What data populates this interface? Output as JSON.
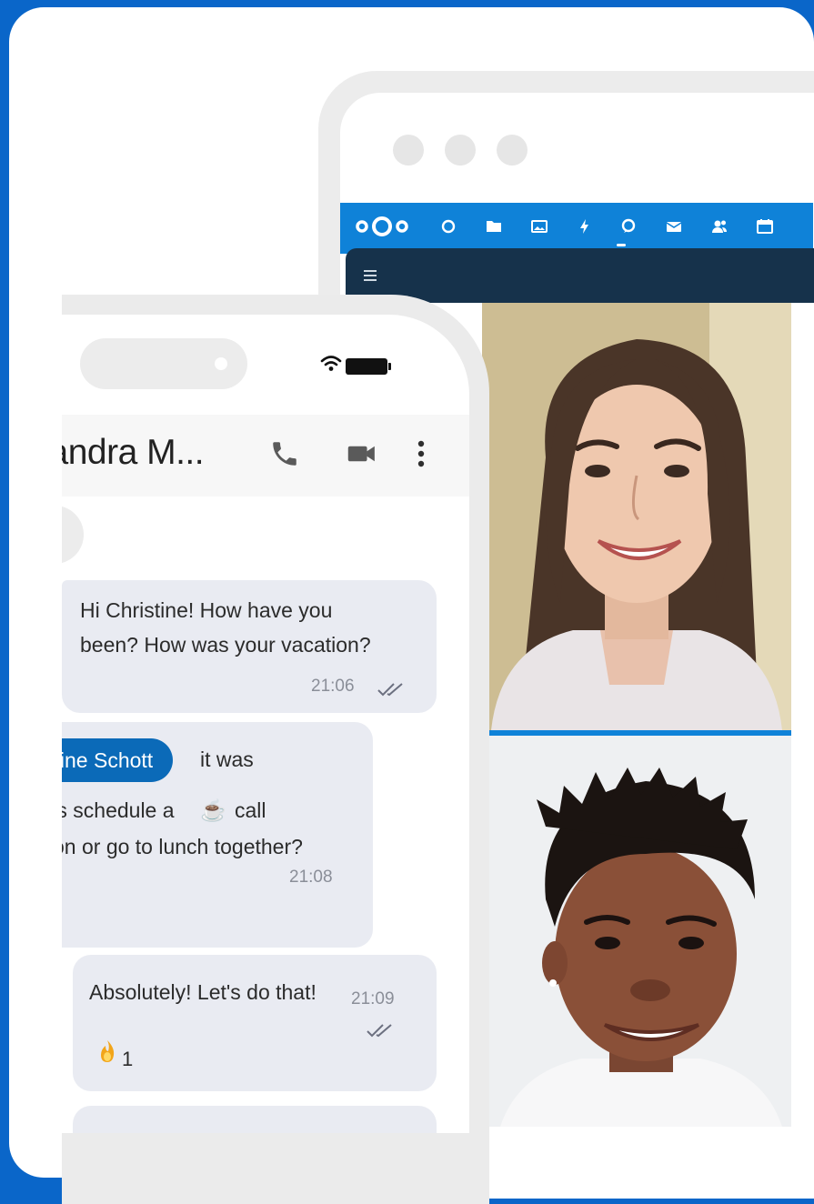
{
  "browser": {
    "app_bar": {
      "icons": [
        "nextcloud-logo",
        "dashboard-icon",
        "files-icon",
        "photos-icon",
        "activity-icon",
        "talk-icon",
        "mail-icon",
        "contacts-icon",
        "calendar-icon"
      ],
      "active_icon": "talk-icon"
    },
    "participants": [
      "participant-video-1",
      "participant-video-2"
    ]
  },
  "phone": {
    "contact_name": "Sandra M...",
    "messages": [
      {
        "line1": "Hi Christine! How have you",
        "line2": "been? How was your vacation?",
        "time": "21:06"
      },
      {
        "mention": "stine Schott",
        "line1_rest": "it was",
        "line2": "'s schedule a",
        "line2_rest": "call",
        "line3": "on or go to lunch together?",
        "time": "21:08"
      },
      {
        "line1": "Absolutely! Let's do that!",
        "time": "21:09",
        "reaction_count": "1"
      }
    ]
  },
  "colors": {
    "frame": "#0a66c9",
    "app_bar": "#0f82d8",
    "header_dark": "#16324b",
    "bubble": "#e9ebf2",
    "mention": "#0b6ab8"
  }
}
